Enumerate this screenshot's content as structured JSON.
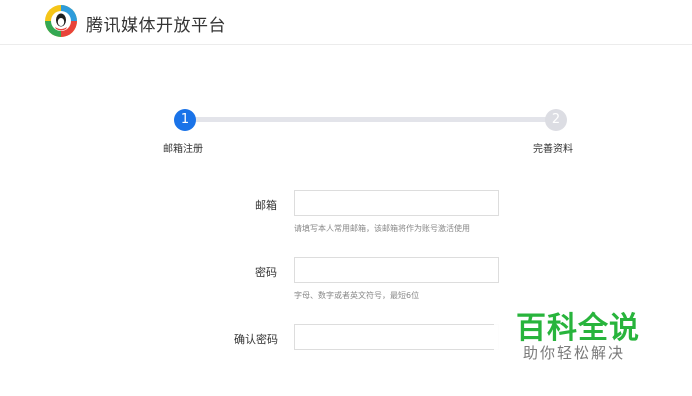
{
  "header": {
    "brand": "腾讯媒体开放平台",
    "logo_icon": "tencent-media-logo-icon"
  },
  "steps": [
    {
      "number": "1",
      "label": "邮箱注册",
      "state": "active"
    },
    {
      "number": "2",
      "label": "完善资料",
      "state": "pending"
    }
  ],
  "form": {
    "email": {
      "label": "邮箱",
      "value": "",
      "hint": "请填写本人常用邮箱，该邮箱将作为账号激活使用"
    },
    "password": {
      "label": "密码",
      "value": "",
      "hint": "字母、数字或者英文符号，最短6位"
    },
    "confirm_password": {
      "label": "确认密码",
      "value": ""
    }
  },
  "watermark": {
    "title": "百科全说",
    "subtitle": "助你轻松解决"
  },
  "colors": {
    "accent": "#1a73e8",
    "track": "#e3e4ea",
    "pending": "#dcdde3",
    "watermark_green": "#28b43c"
  }
}
